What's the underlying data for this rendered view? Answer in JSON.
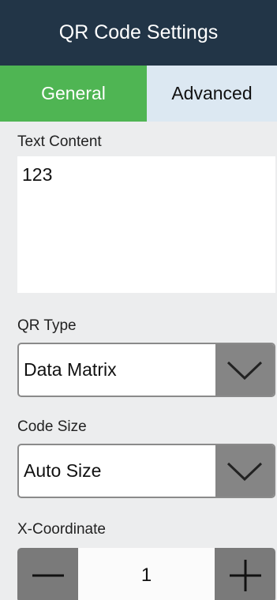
{
  "header": {
    "title": "QR Code Settings"
  },
  "tabs": [
    {
      "label": "General",
      "active": true
    },
    {
      "label": "Advanced",
      "active": false
    }
  ],
  "text_content": {
    "label": "Text Content",
    "value": "123"
  },
  "qr_type": {
    "label": "QR Type",
    "selected": "Data Matrix",
    "icon": "chevron-down-icon"
  },
  "code_size": {
    "label": "Code Size",
    "selected": "Auto Size",
    "icon": "chevron-down-icon"
  },
  "x_coordinate": {
    "label": "X-Coordinate",
    "value": "1",
    "decrement_icon": "minus-icon",
    "increment_icon": "plus-icon"
  },
  "colors": {
    "header_bg": "#223547",
    "tab_active_bg": "#4fb553",
    "tab_inactive_bg": "#dce8f2",
    "arrow_bg": "#858585"
  }
}
